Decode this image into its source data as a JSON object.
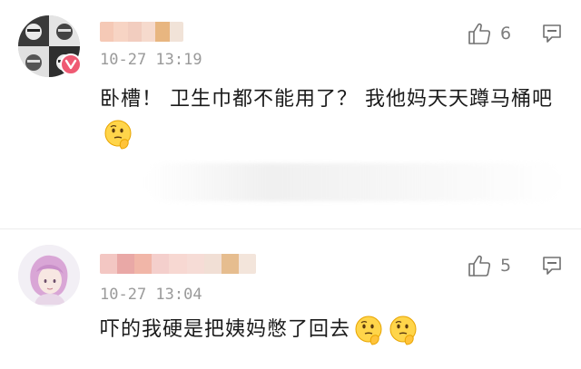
{
  "comments": [
    {
      "time": "10-27 13:19",
      "likes": "6",
      "text": "卧槽！ 卫生巾都不能用了？ 我他妈天天蹲马桶吧",
      "emoji": "thinking-face-icon",
      "verified_badge": "weibo-v-icon",
      "name_colors": [
        "#f5c9b6",
        "#f7d4c4",
        "#f2cdbf",
        "#f6dacd",
        "#e8b680",
        "#f1e3d8"
      ]
    },
    {
      "time": "10-27 13:04",
      "likes": "5",
      "text": "吓的我硬是把姨妈憋了回去",
      "emoji": "thinking-face-icon",
      "name_colors": [
        "#f3c7c3",
        "#e9a8a6",
        "#f1b6a8",
        "#f4cfcc",
        "#f7d8d2",
        "#f6dcd6",
        "#f1dfd5",
        "#e6bd8f",
        "#f3e5db"
      ]
    }
  ],
  "colors": {
    "accent_badge": "#ef5a73",
    "time": "#9a9a9a",
    "count": "#7d7d7d"
  }
}
